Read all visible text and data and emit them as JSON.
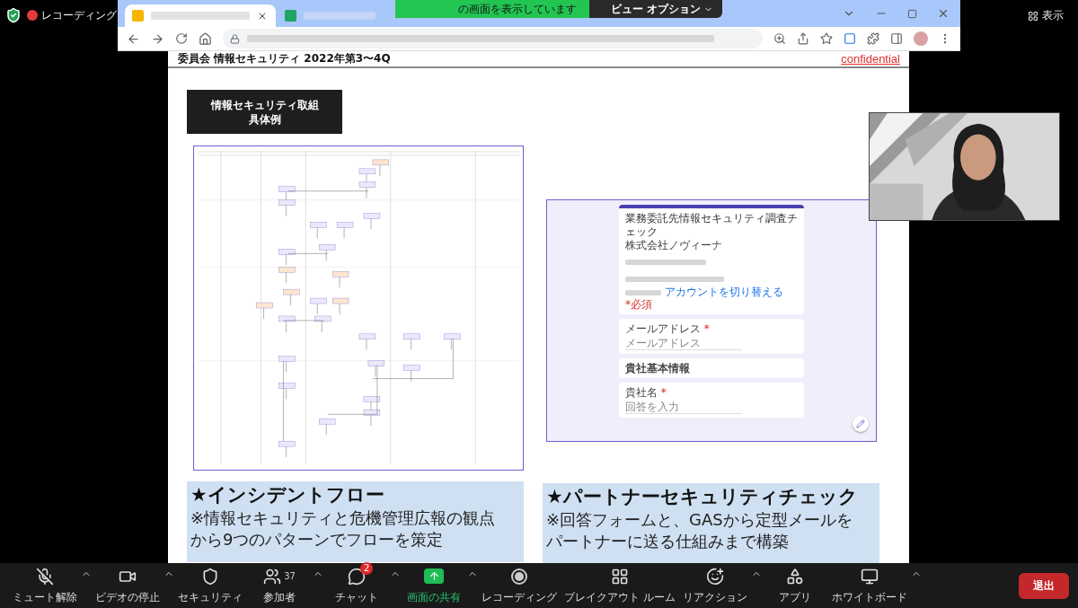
{
  "zoom_top": {
    "recording_label": "レコーディング",
    "share_banner": "の画面を表示しています",
    "view_options": "ビュー オプション",
    "view_label": "表示"
  },
  "browser": {
    "tabs": [
      {
        "kind": "slides",
        "selected": true
      },
      {
        "kind": "sheets",
        "selected": false
      }
    ]
  },
  "slide": {
    "header_title": "委員会 情報セキュリティ 2022年第3〜4Q",
    "confidential": "confidential",
    "title_box": [
      "情報セキュリティ取組",
      "具体例"
    ],
    "form": {
      "title": "業務委託先情報セキュリティ調査チェック",
      "org": "株式会社ノヴィーナ",
      "switch_account": "アカウントを切り替える",
      "required_note": "*必須",
      "required_mark": "*",
      "questions": [
        {
          "kind": "question",
          "label": "メールアドレス",
          "required": true,
          "placeholder": "メールアドレス"
        },
        {
          "kind": "section",
          "label": "貴社基本情報"
        },
        {
          "kind": "question",
          "label": "貴社名",
          "required": true,
          "placeholder": "回答を入力"
        }
      ]
    },
    "captions": [
      {
        "title": "★インシデントフロー",
        "lines": [
          "※情報セキュリティと危機管理広報の観点",
          "から9つのパターンでフローを策定"
        ]
      },
      {
        "title": "★パートナーセキュリティチェック",
        "lines": [
          "※回答フォームと、GASから定型メールを",
          "パートナーに送る仕組みまで構築"
        ]
      }
    ]
  },
  "toolbar": {
    "items": [
      {
        "kind": "mic_off",
        "label": "ミュート解除",
        "menu": true,
        "active": false
      },
      {
        "kind": "video",
        "label": "ビデオの停止",
        "menu": true,
        "active": false
      },
      {
        "kind": "security",
        "label": "セキュリティ",
        "menu": false,
        "active": false
      },
      {
        "kind": "participants",
        "label": "参加者",
        "count": "37",
        "menu": true,
        "active": false
      },
      {
        "kind": "chat",
        "label": "チャット",
        "badge": "2",
        "menu": true,
        "active": false
      },
      {
        "kind": "share",
        "label": "画面の共有",
        "menu": true,
        "active": true
      },
      {
        "kind": "record",
        "label": "レコーディング",
        "menu": false,
        "active": false
      },
      {
        "kind": "breakout",
        "label": "ブレイクアウト ルーム",
        "menu": false,
        "active": false
      },
      {
        "kind": "reaction",
        "label": "リアクション",
        "menu": true,
        "active": false
      },
      {
        "kind": "apps",
        "label": "アプリ",
        "menu": false,
        "active": false
      },
      {
        "kind": "whiteboard",
        "label": "ホワイトボード",
        "menu": true,
        "active": false
      }
    ],
    "leave": "退出"
  }
}
